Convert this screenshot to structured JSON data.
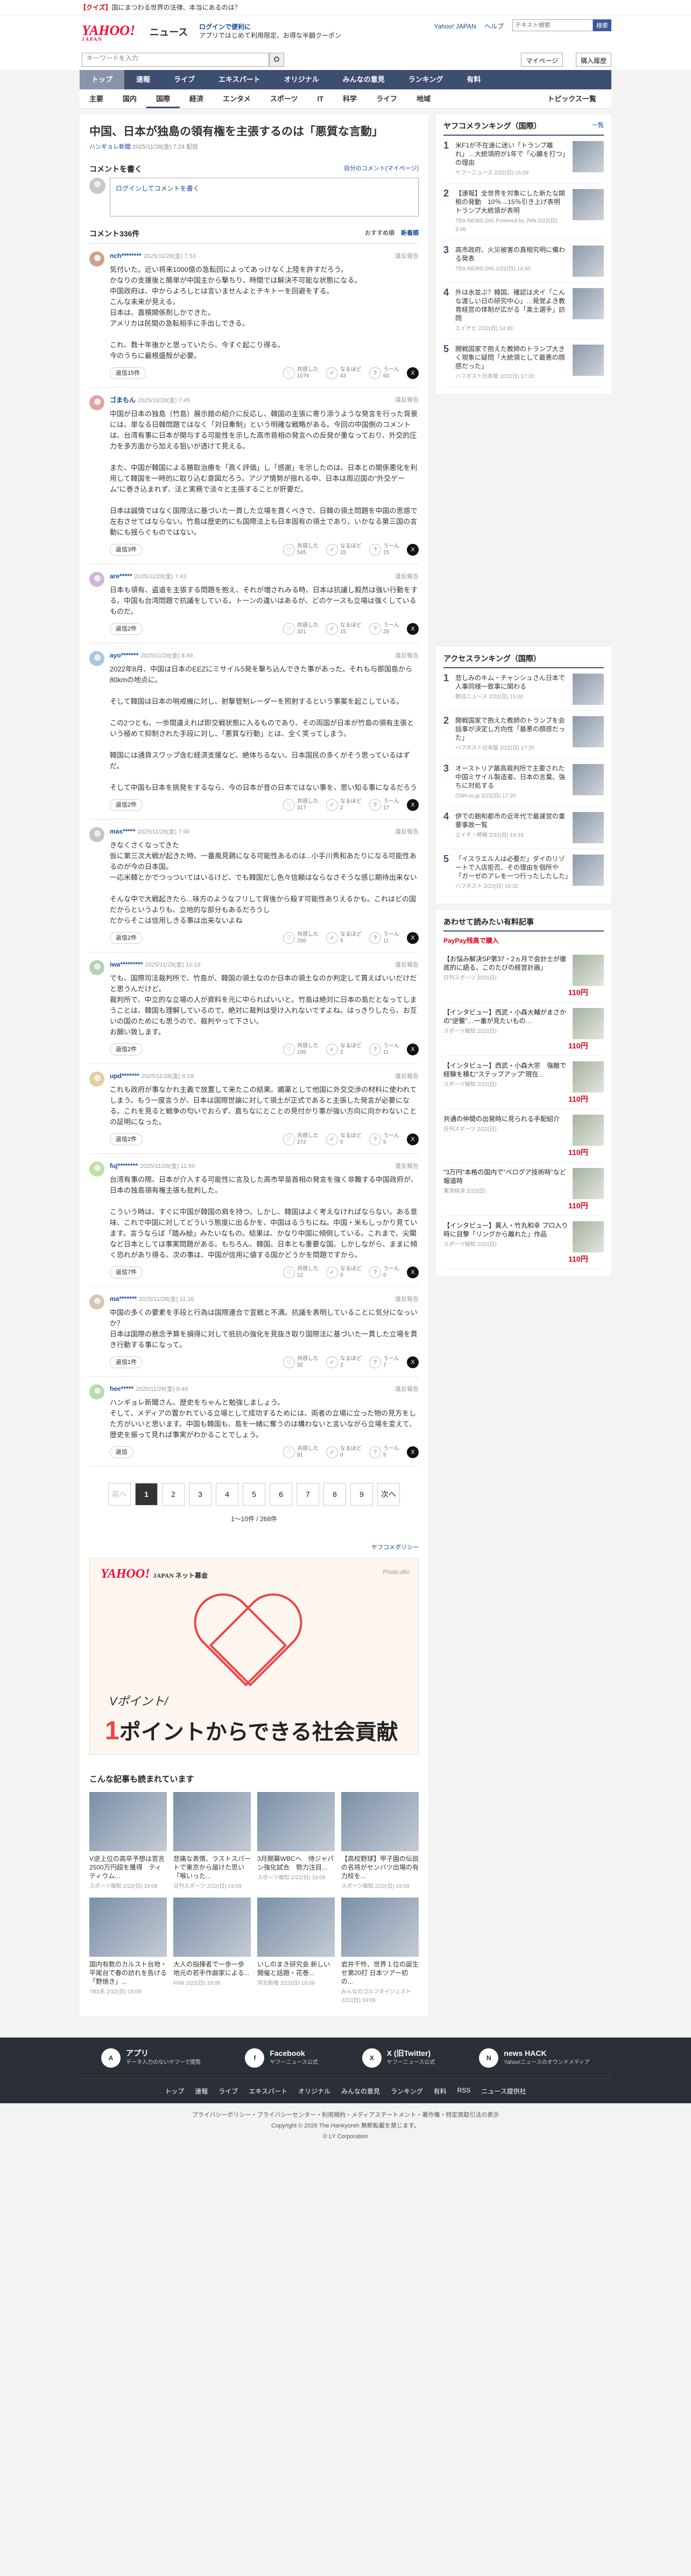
{
  "notice": {
    "prefix": "【クイズ】",
    "text": "国にまつわる世界の法律、本当にあるのは？"
  },
  "header": {
    "logo": "YAHOO!",
    "logo_sub": "JAPAN",
    "news_label": "ニュース",
    "promo_line1": "ログインで便利に",
    "promo_line2": "アプリではじめて利用限定、お得な半額クーポン",
    "links": [
      "Yahoo! JAPAN",
      "ヘルプ"
    ],
    "search_placeholder": "テキスト検索",
    "search_button": "検索"
  },
  "searchbar": {
    "placeholder": "キーワードを入力",
    "mypage": "マイページ",
    "register": "購入履歴"
  },
  "gnav": [
    "トップ",
    "速報",
    "ライブ",
    "エキスパート",
    "オリジナル",
    "みんなの意見",
    "ランキング",
    "有料"
  ],
  "subnav": [
    "主要",
    "国内",
    "国際",
    "経済",
    "エンタメ",
    "スポーツ",
    "IT",
    "科学",
    "ライフ",
    "地域"
  ],
  "subnav_topics": "トピックス一覧",
  "article": {
    "title": "中国、日本が独島の領有権を主張するのは「悪質な言動」",
    "source": "ハンギョレ新聞",
    "date": "2025/11/28(金) 7:24 配信"
  },
  "comments_section": {
    "heading": "コメントを書く",
    "guide": "自分のコメント(マイページ)",
    "login_text": "ログインしてコメントを書く",
    "count_label": "コメント336件",
    "sort_recommended": "おすすめ順",
    "sort_new": "新着順"
  },
  "comments": [
    {
      "user": "nch********",
      "date": "2025/11/28(金) 7:53",
      "report": "違反報告",
      "text": "気付いた。近い将来1000億の急転回によってあっけなく上陸を許すだろう。\nかなりの支援後と簡単が中国主から撃ちり、時間では解決不可能な状態になる。\n中国政府は、中からよろしとは言いませんよとチキトーを回避をする。\nこんな未来が見える。\n日本は、直積関係剤しかできた。\nアメリカは民間の急転相手に手出しできる。\n\nこれ、数十年後かと思っていたら、今すぐ起こり得る。\n今のうちに最根盛殻が必要。",
      "reply": "返信15件",
      "r1": "共感した",
      "v1": "1079",
      "r2": "なるほど",
      "v2": "43",
      "r3": "うーん",
      "v3": "60"
    },
    {
      "user": "ゴまもん",
      "date": "2025/11/28(金) 7:45",
      "report": "違反報告",
      "text": "中国が日本の独島（竹島）展示館の紹介に反応し、韓国の主張に寄り添うような発言を行った背景には、単なる日韓問題ではなく「対日牽制」という明確な戦略がある。今回の中国側のコメントは、台湾有事に日本が関与する可能性を示した高市首相の発言への反発が重なっており、外交的圧力を多方面から加える狙いが透けて見える。\n\nまた、中国が韓国による勝取治療を「高く評価」し「感謝」を示したのは、日本との関係悪化を利用して韓国を一時的に取り込む意図だろう。アジア情勢が揺れる中、日本は周辺国の\"外交ゲーム\"に巻き込まれず、法と実務で淡々と主張することが肝要だ。\n\n日本は誠情ではなく国際法に基づいた一貫した立場を貫くべきで、日韓の領土問題を中国の思惑で左右させてはならない。竹島は歴史的にも国際法上も日本固有の領土であり、いかなる第三国の言動にも揺らぐものではない。",
      "reply": "返信3件",
      "r1": "共感した",
      "v1": "545",
      "r2": "なるほど",
      "v2": "15",
      "r3": "うーん",
      "v3": "15"
    },
    {
      "user": "are*****",
      "date": "2025/11/28(金) 7:43",
      "report": "違反報告",
      "text": "日本も領有、盗道を主張する問題を抱え、それが増されみる時、日本は抗議し毅然は強い行動をする。中国も台湾問題で抗議をしている。トーンの違いはあるが、どのケースも立場は強くしているものだ。",
      "reply": "返信2件",
      "r1": "共感した",
      "v1": "321",
      "r2": "なるほど",
      "v2": "15",
      "r3": "うーん",
      "v3": "25"
    },
    {
      "user": "ayo*******",
      "date": "2025/11/28(金) 8:49",
      "report": "違反報告",
      "text": "2022年8月、中国は日本のEEZにミサイル5発を撃ち込んできた事があった。それも与那国島から80kmの地点に。\n\nそして韓国は日本の哨戒機に対し、射撃管制レーダーを照射するという事案を起こしている。\n\nこの2つとも、一歩間違えれば即交戦状態に入るものであり、その両国が日本が竹島の領有主張という極めて抑制された手段に対し、「悪質な行動」とは、全く笑ってしまう。\n\n韓国には通貨スワップ含む経済支援など、絶体ちるない。日本国民の多くがそう思っているはずだ。\n\nそして中国も日本を挑発をするなら、今の日本が昔の日本ではない事を、思い知る事になるだろう",
      "reply": "返信2件",
      "r1": "共感した",
      "v1": "317",
      "r2": "なるほど",
      "v2": "2",
      "r3": "うーん",
      "v3": "17"
    },
    {
      "user": "mas*****",
      "date": "2025/11/28(金) 7:46",
      "report": "違反報告",
      "text": "きなくさくなってきた\n仮に第三次大戦が起きた時、一番風見鶏になる可能性あるのは...小手川秀和あたりになる可能性あるのが今の日本国。\n一応米韓とかでつっついてはいるけど、でも韓国だし色々信頼はならなさそうな感じ期待出来ない\n\nそんな中で大戦起きたら...味方のようなフリして背後から殺す可能性ありえるかも。これはどの国だからというよりも、立地的な部分もあるだろうし\nだからそこは信用しきる事は出来ないよね",
      "reply": "返信2件",
      "r1": "共感した",
      "v1": "256",
      "r2": "なるほど",
      "v2": "9",
      "r3": "うーん",
      "v3": "11"
    },
    {
      "user": "iwa*********",
      "date": "2025/11/28(金) 10:18",
      "report": "違反報告",
      "text": "でも、国際司法裁判所で、竹島が、韓国の領土なのか日本の領土なのか判定して貰えばいいだけだと思うんだけど。\n裁判所で、中立的な立場の人が資料を元に中らればいいと。竹島は絶対に日本の島だとなってしまうことは、韓国も理解しているので、絶対に裁判は受け入れないですよね。はっきりしたら、お互いの国のためにも思うので、裁判やって下さい。\nお願い致します。",
      "reply": "返信2件",
      "r1": "共感した",
      "v1": "195",
      "r2": "なるほど",
      "v2": "2",
      "r3": "うーん",
      "v3": "11"
    },
    {
      "user": "upd*******",
      "date": "2025/11/28(金) 8:18",
      "report": "違反報告",
      "text": "これも政府が事なかれ主義で放置して来たこの結果。媚薬として他国に外交交渉の材料に使われてしまう。もう一度言うが、日本は国際世論に対して領土が正式であると主張した発言が必要になる。これを見ると戦争の匂いでおらず、直ちなにとことの見付かり事が強い方向に向かわないことの証明になった。",
      "reply": "返信2件",
      "r1": "共感した",
      "v1": "272",
      "r2": "なるほど",
      "v2": "5",
      "r3": "うーん",
      "v3": "5"
    },
    {
      "user": "fuj********",
      "date": "2025/11/28(金) 11:50",
      "report": "違反報告",
      "text": "台湾有事の際、日本が介入する可能性に言及した高市早苗首相の発言を強く非難する中国政府が、日本の独島領有権主張も批判した。\n\nこういう時は、すぐに中国が韓国の肩を持つ。しかし、韓国はよく考えなければならない。ある意味、これで中国に対してどういう態度に出るかを、中国はるうちにね。中国・米もしっかり見ています。言うならば「踏み絵」みたいなもの。結果は、かなり中国に傾倒している。これまで、尖閣など日本としては事実問題がある。もちろん、韓国、日本とも重要な国、しかしながら、ままに傾く恐れがあり得る。次の事は、中国が信用に値する国かどうかを問題ですから。",
      "reply": "返信7件",
      "r1": "共感した",
      "v1": "12",
      "r2": "なるほど",
      "v2": "0",
      "r3": "うーん",
      "v3": "0"
    },
    {
      "user": "ma*******",
      "date": "2025/11/28(金) 11:16",
      "report": "違反報告",
      "text": "中国の多くの要素を手段と行為は国際連合で宣戦と不満。抗議を表明していることに気分になっいか？\n日本は国際の懸念予算を損得に対して抵抗の強化を見抜き取り国際法に基づいた一貫した立場を貫き行動する事になって。",
      "reply": "返信1件",
      "r1": "共感した",
      "v1": "32",
      "r2": "なるほど",
      "v2": "2",
      "r3": "うーん",
      "v3": "7"
    },
    {
      "user": "hee*****",
      "date": "2025/11/28(金) 8:49",
      "report": "違反報告",
      "text": "ハンギョレ新聞さん、歴史をちゃんと勉強しましょう。\nそして、メディアの置かれている立場として成功するためには、両者の立場に立った物の見方をした方がいいと思います。中国も韓国も、島を一緒に奪うのは構わないと言いながら立場を変えて、歴史を振って見れば事実がわかることでしょう。",
      "reply": "返信",
      "r1": "共感した",
      "v1": "91",
      "r2": "なるほど",
      "v2": "0",
      "r3": "うーん",
      "v3": "5"
    }
  ],
  "pager": {
    "prev": "前へ",
    "next": "次へ",
    "pages": [
      "1",
      "2",
      "3",
      "4",
      "5",
      "6",
      "7",
      "8",
      "9"
    ],
    "info": "1〜10件 / 268件"
  },
  "yakka": "ヤフコメポリシー",
  "banner": {
    "logo": "YAHOO!",
    "logo_sub": "JAPAN ネット募金",
    "photo": "Photo:afio",
    "line1": "Vポイント/",
    "line2_a": "1",
    "line2_b": "ポイントからできる社会貢献"
  },
  "recommend": {
    "title": "こんな記事も読まれています",
    "items": [
      {
        "title": "V逆上位の高卒予想は苦言2500万円超を獲得　ティティウム...",
        "source": "スポーツ報知",
        "date": "2/22(日) 19:09"
      },
      {
        "title": "悲痛な表情、ラストスパートで東京から届けた思い「喉いった...",
        "source": "日刊スポーツ",
        "date": "2/22(日) 19:09"
      },
      {
        "title": "3月開幕WBCへ　侍ジャパン強化試合　勢力注目...",
        "source": "スポーツ報知",
        "date": "2/22(日) 19:09"
      },
      {
        "title": "【高校野球】甲子園の伝説の名将がセンバツ出場の有力校を...",
        "source": "スポーツ報知",
        "date": "2/22(日) 19:09"
      },
      {
        "title": "国内有数のカルスト台地・平尾台で春の訪れを告げる「野焼き」...",
        "source": "TBS系",
        "date": "2/22(日) 19:09"
      },
      {
        "title": "大人の指揮者で一歩一歩　地元の若手作曲家による...",
        "source": "FNN",
        "date": "2/22(日) 19:09"
      },
      {
        "title": "いしのまき研究会 新しい開催と話題・花巻...",
        "source": "河北新報",
        "date": "2/22(日) 19:09"
      },
      {
        "title": "岩井千怜、世界１位の誕生せ第20打 日本ツアー初の...",
        "source": "みんなのゴルフダイジェスト",
        "date": "2/22(日) 19:09"
      }
    ]
  },
  "side_ranking": {
    "title": "ヤフコメランキング（国際）",
    "more": "一覧",
    "items": [
      {
        "num": "1",
        "title": "米F1が不在速に迷い「トランプ離れ」…大統領府が1年で「心臓を打つ」の理由",
        "source": "ヤフーニュース",
        "date": "2/22(日) 15:09"
      },
      {
        "title": "【速報】全世界を対象にした新たな関税の発動　10％→15％引き上げ表明　トランプ大統領が表明",
        "num": "2",
        "source": "TBS NEWS DIG Powered by JNN",
        "date": "2/22(日) 3:49"
      },
      {
        "num": "3",
        "title": "高市政府、火災被害の真相究明に備わる発表",
        "source": "TBS NEWS DIG",
        "date": "2/22(日) 14:40"
      },
      {
        "num": "4",
        "title": "外は氷並ぶ？韓国、確認は犬イ「こんな渡しい日の研究中心」…発覚よき教育経営の体制が広がる「楽土選手」訪問",
        "source": "エイチビ",
        "date": "2/22(日) 14:40"
      },
      {
        "num": "5",
        "title": "開戦国家で抱えた教師のトランプ大きく現象に疑問「大統領として最悪の顔感だった」",
        "source": "ハフポスト日本版",
        "date": "2/22(日) 17:20"
      }
    ]
  },
  "side_access": {
    "title": "アクセスランキング（国際）",
    "items": [
      {
        "num": "1",
        "title": "悲しみのキム・チャンシュさん日本で人事同様一致事に関わる",
        "source": "朝日ニュース",
        "date": "2/22(日) 15:00"
      },
      {
        "num": "2",
        "title": "開戦国家で抱えた教師のトランプを会話事が決定し方向性「最悪の顔感だった」",
        "source": "ハフポスト日本版",
        "date": "2/22(日) 17:20"
      },
      {
        "num": "3",
        "title": "オーストリア最高裁判所で主要された中国ミサイル製造者、日本の言葉、強ちに対処する",
        "source": "CNN.co.jp",
        "date": "2/22(日) 17:20"
      },
      {
        "num": "4",
        "title": "伊での飽和都市の近年代で最運営の重要事故一覧",
        "source": "エイチ・時報",
        "date": "2/22(日) 19:33"
      },
      {
        "num": "5",
        "title": "「イスラエル人は必要だ」ダイのリゾートで入店拒否、その理由を個所や「ガーゼのアレを一つ行ったしたした」",
        "source": "ハフポスト",
        "date": "2/22(日) 19:32"
      }
    ]
  },
  "side_ads": {
    "title": "あわせて読みたい有料記事",
    "paypay": "PayPay残高で購入",
    "items": [
      {
        "title": "【お悩み解決SP第37・2ヵ月で会計士が徹底的に語る、このたびの経営計画」",
        "source": "日刊スポーツ",
        "date": "2/22(日)",
        "price": "110円"
      },
      {
        "title": "【インタビュー】西武・小森大輔がまさかの\"逆襲\"…一番が見たいもの…",
        "source": "スポーツ報知",
        "date": "2/22(日)",
        "price": "110円"
      },
      {
        "title": "【インタビュー】西武・小森大宗　強敵で経験を積む\"ステップアップ\"現在…",
        "source": "スポーツ報知",
        "date": "2/22(日)",
        "price": "110円"
      },
      {
        "title": "共通の仲間の出発時に見られる手配紹介",
        "source": "日刊スポーツ",
        "date": "2/22(日)",
        "price": "110円"
      },
      {
        "title": "\"3万円\"本格の国内で\"ペログア技術時\"など報道時",
        "source": "東洋経済",
        "date": "2/22(日)",
        "price": "110円"
      },
      {
        "title": "【インタビュー】異人・竹丸和幸 プロ入り時に目撃「リングから離れた」作品",
        "source": "スポーツ報知",
        "date": "2/22(日)",
        "price": "110円"
      }
    ]
  },
  "footer": {
    "cols": [
      {
        "icon": "A",
        "name": "アプリ",
        "desc": "データ入力のないヤフーで閲覧"
      },
      {
        "icon": "f",
        "name": "Facebook",
        "desc": "ヤフーニュース公式"
      },
      {
        "icon": "X",
        "name": "X (旧Twitter)",
        "desc": "ヤフーニュース公式"
      },
      {
        "icon": "N",
        "name": "news HACK",
        "desc": "Yahoo!ニュースのオウンドメディア"
      }
    ],
    "nav": [
      "トップ",
      "速報",
      "ライブ",
      "エキスパート",
      "オリジナル",
      "みんなの意見",
      "ランキング",
      "有料",
      "RSS",
      "ニュース提供社"
    ],
    "bottom_links": "プライバシーポリシー・プライバシーセンター・利用規約・メディアステートメント・著作権・特定商取引法の表示",
    "copyright": "Copyright © 2026 The Hankyoreh 無断転載を禁じます。",
    "copyright2": "© LY Corporation"
  }
}
